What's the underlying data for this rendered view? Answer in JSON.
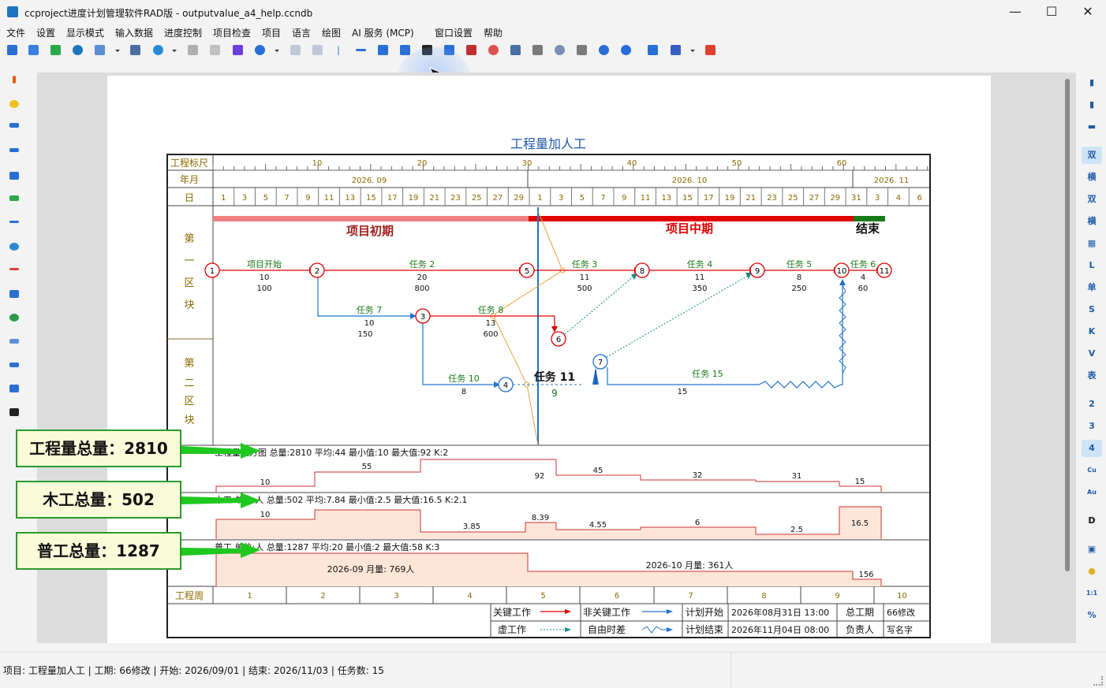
{
  "window": {
    "title": "ccproject进度计划管理软件RAD版 - outputvalue_a4_help.ccndb",
    "minimize_glyph": "—",
    "maximize_glyph": "☐",
    "close_glyph": "✕"
  },
  "menu": [
    "文件",
    "设置",
    "显示模式",
    "输入数据",
    "进度控制",
    "项目检查",
    "项目",
    "语言",
    "绘图",
    "AI 服务 (MCP)",
    "窗口设置",
    "帮助"
  ],
  "right_toolbar": [
    "双",
    "横",
    "双",
    "横",
    "",
    "L",
    "单",
    "S",
    "K",
    "V",
    "表",
    "2",
    "3",
    "4",
    "Cu",
    "Au",
    "D",
    "",
    "",
    "1:1",
    "%"
  ],
  "chart": {
    "title": "工程量加人工",
    "scale_label": "工程标尺",
    "month_label": "年月",
    "day_label": "日",
    "scale_ticks": [
      "10",
      "20",
      "30",
      "40",
      "50",
      "60"
    ],
    "months": [
      "2026. 09",
      "2026. 10",
      "2026. 11"
    ],
    "days": [
      "1",
      "3",
      "5",
      "7",
      "9",
      "11",
      "13",
      "15",
      "17",
      "19",
      "21",
      "23",
      "25",
      "27",
      "29",
      "1",
      "3",
      "5",
      "7",
      "9",
      "11",
      "13",
      "15",
      "17",
      "19",
      "21",
      "23",
      "25",
      "27",
      "29",
      "31",
      "3",
      "4",
      "6"
    ],
    "zone1_label": [
      "第",
      "一",
      "区",
      "块"
    ],
    "zone2_label": [
      "第",
      "二",
      "区",
      "块"
    ],
    "phases": [
      {
        "name": "项目初期",
        "color": "#f08080"
      },
      {
        "name": "项目中期",
        "color": "#e00000"
      },
      {
        "name": "结束",
        "color": "#1a7a1a"
      }
    ],
    "tasks": [
      {
        "name": "项目开始",
        "duration": "10",
        "quantity": "100"
      },
      {
        "name": "任务 2",
        "duration": "20",
        "quantity": "800"
      },
      {
        "name": "任务 3",
        "duration": "11",
        "quantity": "500"
      },
      {
        "name": "任务 4",
        "duration": "11",
        "quantity": "350"
      },
      {
        "name": "任务 5",
        "duration": "8",
        "quantity": "250"
      },
      {
        "name": "任务 6",
        "duration": "4",
        "quantity": "60"
      },
      {
        "name": "任务 7",
        "duration": "10",
        "quantity": "150"
      },
      {
        "name": "任务 8",
        "duration": "13",
        "quantity": "600"
      },
      {
        "name": "任务 10",
        "duration": "8",
        "quantity": ""
      },
      {
        "name": "任务 11",
        "duration": "9",
        "quantity": ""
      },
      {
        "name": "任务 15",
        "duration": "15",
        "quantity": ""
      }
    ],
    "nodes": [
      "1",
      "2",
      "3",
      "4",
      "5",
      "6",
      "7",
      "8",
      "9",
      "10",
      "11"
    ],
    "histogram1": {
      "header": "工程量直方图 总量:2810 平均:44 最小值:10 最大值:92 K:2",
      "values": [
        "10",
        "55",
        "92",
        "45",
        "32",
        "31",
        "15"
      ]
    },
    "histogram2": {
      "header": "木工 单位:人 总量:502 平均:7.84 最小值:2.5 最大值:16.5 K:2.1",
      "values": [
        "10",
        "3.85",
        "8.39",
        "4.55",
        "6",
        "2.5",
        "16.5"
      ]
    },
    "histogram3": {
      "header": "普工 单位:人 总量:1287 平均:20 最小值:2 最大值:58 K:3",
      "month_sums": [
        "2026-09 月量: 769人",
        "2026-10 月量: 361人"
      ],
      "values": [
        "156"
      ]
    },
    "week_label": "工程周",
    "weeks": [
      "1",
      "2",
      "3",
      "4",
      "5",
      "6",
      "7",
      "8",
      "9",
      "10"
    ],
    "legend": {
      "critical": "关键工作",
      "non_critical": "非关键工作",
      "dummy": "虚工作",
      "free_float": "自由时差",
      "plan_start_label": "计划开始",
      "plan_start_value": "2026年08月31日 13:00",
      "plan_end_label": "计划结束",
      "plan_end_value": "2026年11月04日 08:00",
      "duration_label": "总工期",
      "duration_value": "66修改",
      "owner_label": "负责人",
      "owner_value": "写名字"
    }
  },
  "callouts": [
    "工程量总量：2810",
    "木工总量：502",
    "普工总量：1287"
  ],
  "status": "项目: 工程量加人工 | 工期: 66修改 | 开始: 2026/09/01 | 结束: 2026/11/03 | 任务数: 15",
  "colors": {
    "critical": "#e00000",
    "non_critical": "#1e73d0",
    "accent": "#1e5aa8",
    "callout_border": "#2a9b2a",
    "hist_fill": "#fde6d8",
    "progress_line": "#1e73d0",
    "adjust_line": "#f0a040"
  }
}
